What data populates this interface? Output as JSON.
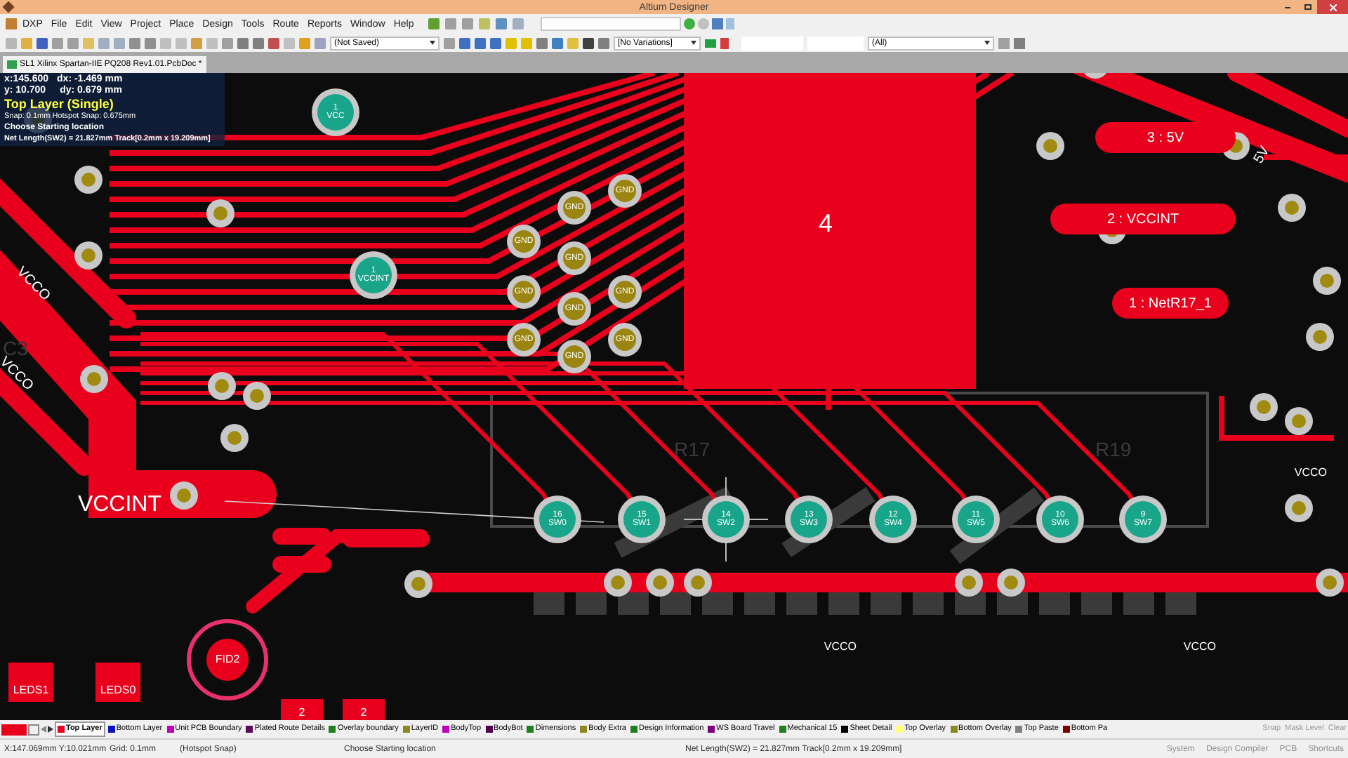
{
  "window": {
    "title": "Altium Designer"
  },
  "menu": [
    "DXP",
    "File",
    "Edit",
    "View",
    "Project",
    "Place",
    "Design",
    "Tools",
    "Route",
    "Reports",
    "Window",
    "Help"
  ],
  "toolbar": {
    "document_state": "(Not Saved)",
    "variations": "[No Variations]",
    "filter": "(All)"
  },
  "document_tab": {
    "title": "SL1 Xilinx Spartan-IIE PQ208 Rev1.01.PcbDoc *",
    "selected": true
  },
  "hud": {
    "x": "x:145.600",
    "dx": "dx: -1.469 mm",
    "y": "y: 10.700",
    "dy": "dy: 0.679 mm",
    "layer": "Top Layer (Single)",
    "snap": "Snap: 0.1mm Hotspot Snap: 0.675mm",
    "action": "Choose Starting location",
    "net_length": "Net Length(SW2) = 21.827mm Track[0.2mm x 19.209mm]"
  },
  "board": {
    "component_label": "4",
    "power_pads": [
      {
        "number": "1",
        "net": "VCC"
      },
      {
        "number": "1",
        "net": "VCCINT"
      }
    ],
    "gnd_pads": [
      "GND",
      "GND",
      "GND",
      "GND",
      "GND",
      "GND",
      "GND",
      "GND",
      "GND",
      "GND"
    ],
    "switch_pads": [
      {
        "number": "16",
        "net": "SW0"
      },
      {
        "number": "15",
        "net": "SW1"
      },
      {
        "number": "14",
        "net": "SW2"
      },
      {
        "number": "13",
        "net": "SW3"
      },
      {
        "number": "12",
        "net": "SW4"
      },
      {
        "number": "11",
        "net": "SW5"
      },
      {
        "number": "10",
        "net": "SW6"
      },
      {
        "number": "9",
        "net": "SW7"
      }
    ],
    "net_pads": [
      "3 : 5V",
      "2 : VCCINT",
      "1 : NetR17_1"
    ],
    "net_labels": [
      {
        "text": "5V",
        "kind": "rotated"
      },
      {
        "text": "VCCINT",
        "kind": "large"
      },
      {
        "text": "VCCO",
        "kind": "rotated"
      },
      {
        "text": "VCCO",
        "kind": "rotated"
      },
      {
        "text": "VCCO",
        "kind": "plain"
      },
      {
        "text": "VCCO",
        "kind": "plain"
      },
      {
        "text": "VCCO",
        "kind": "plain"
      }
    ],
    "silkscreen": [
      "R17",
      "R19",
      "C3"
    ],
    "fiducial": "FID2",
    "led_pads": [
      "LEDS1",
      "LEDS0"
    ],
    "small_pads": [
      "2",
      "2"
    ]
  },
  "layer_tabs": [
    {
      "label": "Top Layer",
      "color": "#e8001c",
      "selected": true
    },
    {
      "label": "Bottom Layer",
      "color": "#1010c0",
      "selected": false
    },
    {
      "label": "Unit PCB Boundary",
      "color": "#c000c0",
      "selected": false
    },
    {
      "label": "Plated Route Details",
      "color": "#5a0a5a",
      "selected": false
    },
    {
      "label": "Overlay boundary",
      "color": "#208020",
      "selected": false
    },
    {
      "label": "LayerID",
      "color": "#8a8a20",
      "selected": false
    },
    {
      "label": "BodyTop",
      "color": "#c000c0",
      "selected": false
    },
    {
      "label": "BodyBot",
      "color": "#500050",
      "selected": false
    },
    {
      "label": "Dimensions",
      "color": "#208020",
      "selected": false
    },
    {
      "label": "Body Extra",
      "color": "#8a8a20",
      "selected": false
    },
    {
      "label": "Design Information",
      "color": "#208020",
      "selected": false
    },
    {
      "label": "WS Board Travel",
      "color": "#800080",
      "selected": false
    },
    {
      "label": "Mechanical 15",
      "color": "#208020",
      "selected": false
    },
    {
      "label": "Sheet Detail",
      "color": "#000000",
      "selected": false
    },
    {
      "label": "Top Overlay",
      "color": "#ffff80",
      "selected": false
    },
    {
      "label": "Bottom Overlay",
      "color": "#8a8a20",
      "selected": false
    },
    {
      "label": "Top Paste",
      "color": "#808080",
      "selected": false
    },
    {
      "label": "Bottom Pa",
      "color": "#800000",
      "selected": false
    }
  ],
  "layer_controls": [
    "Snap",
    "Mask Level",
    "Clear"
  ],
  "status_bar": {
    "coords": "X:147.069mm Y:10.021mm",
    "grid": "Grid: 0.1mm",
    "snap": "(Hotspot Snap)",
    "action": "Choose Starting location",
    "net_length": "Net Length(SW2) = 21.827mm Track[0.2mm x 19.209mm]",
    "panels": [
      "System",
      "Design Compiler",
      "PCB",
      "Shortcuts"
    ]
  }
}
